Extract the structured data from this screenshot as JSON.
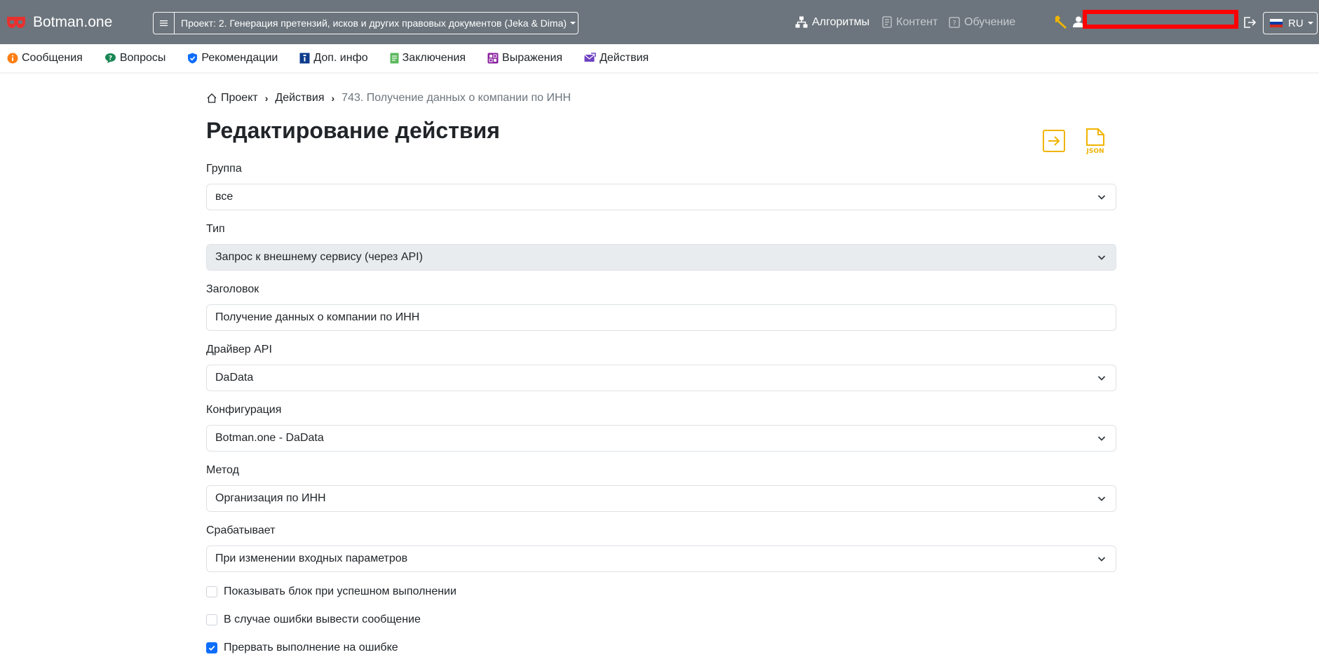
{
  "brand": {
    "name": "Botman.one"
  },
  "project": {
    "label": "Проект: 2. Генерация претензий, исков и других правовых документов (Jeka & Dima)"
  },
  "topnav": {
    "algorithms": "Алгоритмы",
    "content": "Контент",
    "learning": "Обучение",
    "lang": "RU"
  },
  "subnav": {
    "items": [
      {
        "label": "Сообщения",
        "icon": "info-circle-icon",
        "color": "#fd7e14"
      },
      {
        "label": "Вопросы",
        "icon": "chat-question-icon",
        "color": "#198754"
      },
      {
        "label": "Рекомендации",
        "icon": "shield-check-icon",
        "color": "#0d6efd"
      },
      {
        "label": "Доп. инфо",
        "icon": "info-square-icon",
        "color": "#0d3b8c"
      },
      {
        "label": "Заключения",
        "icon": "document-icon",
        "color": "#5cb85c"
      },
      {
        "label": "Выражения",
        "icon": "expression-icon",
        "color": "#8a1fa0"
      },
      {
        "label": "Действия",
        "icon": "envelope-arrow-icon",
        "color": "#6f42c1"
      }
    ]
  },
  "breadcrumb": {
    "home": "Проект",
    "section": "Действия",
    "current": "743. Получение данных о компании по ИНН"
  },
  "page": {
    "title": "Редактирование действия"
  },
  "actions": {
    "json_label": "JSON",
    "accent": "#f0b400"
  },
  "form": {
    "group": {
      "label": "Группа",
      "value": "все"
    },
    "type": {
      "label": "Тип",
      "value": "Запрос к внешнему сервису (через API)"
    },
    "heading": {
      "label": "Заголовок",
      "value": "Получение данных о компании по ИНН"
    },
    "driver": {
      "label": "Драйвер API",
      "value": "DaData"
    },
    "config": {
      "label": "Конфигурация",
      "value": "Botman.one - DaData"
    },
    "method": {
      "label": "Метод",
      "value": "Организация по ИНН"
    },
    "trigger": {
      "label": "Срабатывает",
      "value": "При изменении входных параметров"
    },
    "show_block": {
      "label": "Показывать блок при успешном выполнении",
      "checked": false
    },
    "error_message": {
      "label": "В случае ошибки вывести сообщение",
      "checked": false
    },
    "stop_on_error": {
      "label": "Прервать выполнение на ошибке",
      "checked": true
    }
  }
}
